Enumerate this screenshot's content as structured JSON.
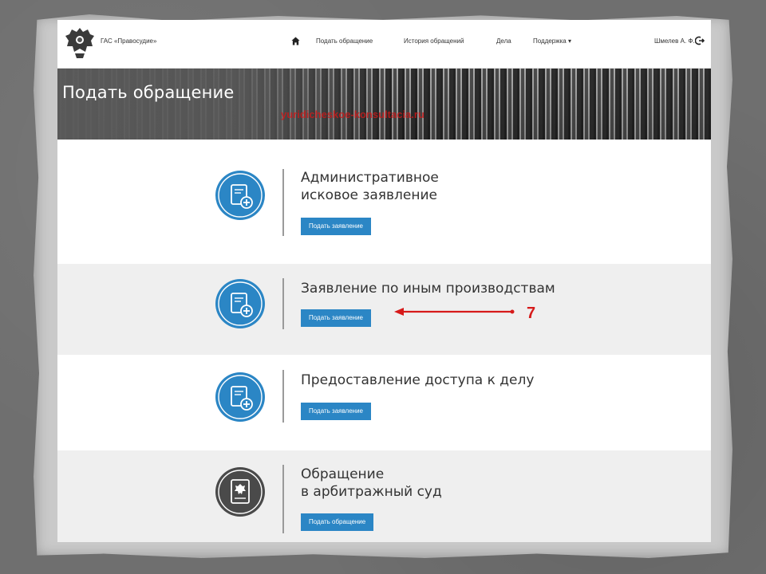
{
  "header": {
    "brand": "ГАС «Правосудие»",
    "nav": [
      {
        "label": "Подать обращение"
      },
      {
        "label": "История обращений"
      },
      {
        "label": "Дела"
      },
      {
        "label": "Поддержка ▾"
      }
    ],
    "user": "Шмелев А. Ф."
  },
  "banner": {
    "title": "Подать обращение",
    "watermark": "yuridicheskoe-konsultacia.ru"
  },
  "sections": [
    {
      "title_lines": [
        "Административное",
        "исковое заявление"
      ],
      "button": "Подать заявление",
      "icon": "document-plus-icon",
      "color": "#2b86c5"
    },
    {
      "title_lines": [
        "Заявление по иным производствам"
      ],
      "button": "Подать заявление",
      "icon": "document-plus-icon",
      "color": "#2b86c5"
    },
    {
      "title_lines": [
        "Предоставление доступа к делу"
      ],
      "button": "Подать заявление",
      "icon": "document-plus-icon",
      "color": "#2b86c5"
    },
    {
      "title_lines": [
        "Обращение",
        "в арбитражный суд"
      ],
      "button": "Подать обращение",
      "icon": "court-document-icon",
      "color": "#4a4a4a"
    }
  ],
  "annotation": {
    "number": "7",
    "color": "#d61a1a"
  },
  "colors": {
    "accent": "#2b86c5",
    "page_bg": "#ffffff",
    "alt_row_bg": "#efefef"
  }
}
